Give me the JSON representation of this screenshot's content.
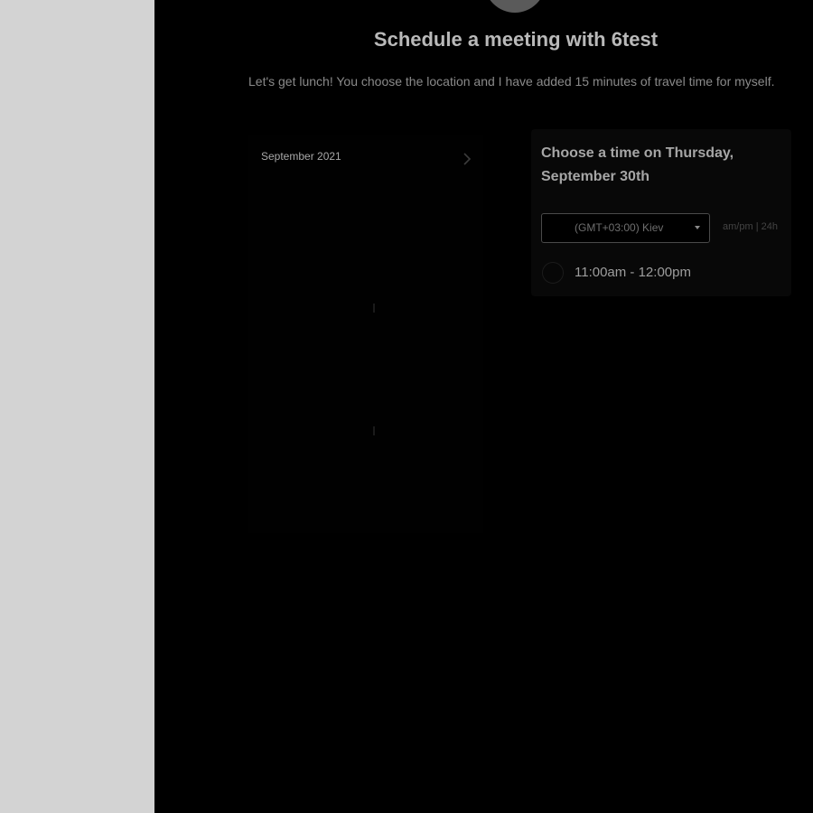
{
  "header": {
    "title": "Schedule a meeting with 6test",
    "description": "Let's get lunch! You choose the location and I have added 15 minutes of travel time for myself."
  },
  "calendar": {
    "month_label": "September 2021",
    "next_icon": "chevron-right-icon"
  },
  "time_panel": {
    "heading": "Choose a time on Thursday, September 30th",
    "timezone": "(GMT+03:00) Kiev",
    "format_ampm": "am/pm",
    "format_separator": "|",
    "format_24h": "24h",
    "slots": [
      {
        "label": "11:00am - 12:00pm"
      }
    ]
  },
  "colors": {
    "overlay_background": "#000000",
    "side_background": "#d3d3d3",
    "heading_text": "#b9b9b9"
  }
}
